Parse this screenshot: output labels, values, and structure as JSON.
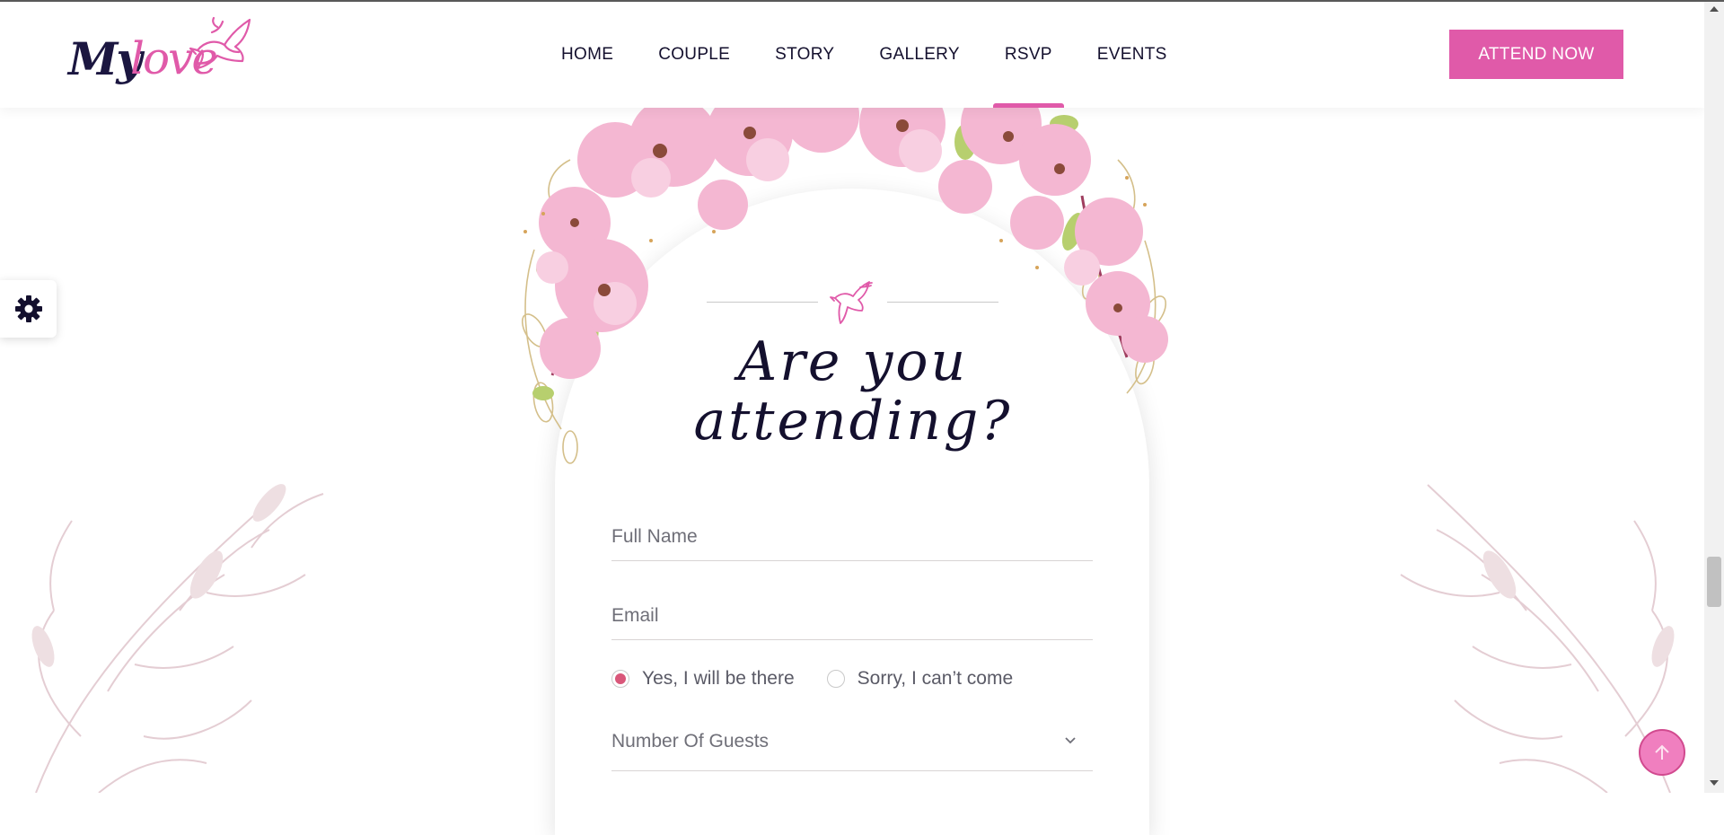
{
  "header": {
    "logo": {
      "part1": "My",
      "part2": "love",
      "icon": "dove-icon"
    },
    "nav": [
      {
        "label": "HOME"
      },
      {
        "label": "COUPLE"
      },
      {
        "label": "STORY"
      },
      {
        "label": "GALLERY"
      },
      {
        "label": "RSVP",
        "active": true
      },
      {
        "label": "EVENTS"
      }
    ],
    "cta_label": "ATTEND NOW"
  },
  "settings": {
    "icon": "gear-icon"
  },
  "rsvp": {
    "icon": "dove-icon",
    "title_line1": "Are you",
    "title_line2": "attending?",
    "full_name": {
      "placeholder": "Full Name",
      "value": ""
    },
    "email": {
      "placeholder": "Email",
      "value": ""
    },
    "attendance_options": [
      {
        "label": "Yes, I will be there",
        "selected": true
      },
      {
        "label": "Sorry, I can’t come",
        "selected": false
      }
    ],
    "guests": {
      "selected": "Number Of Guests",
      "icon": "chevron-down-icon"
    }
  },
  "back_to_top": {
    "icon": "arrow-up-icon"
  },
  "colors": {
    "accent": "#e05aa9",
    "navy": "#14102e",
    "radio_selected": "#d9577a"
  }
}
